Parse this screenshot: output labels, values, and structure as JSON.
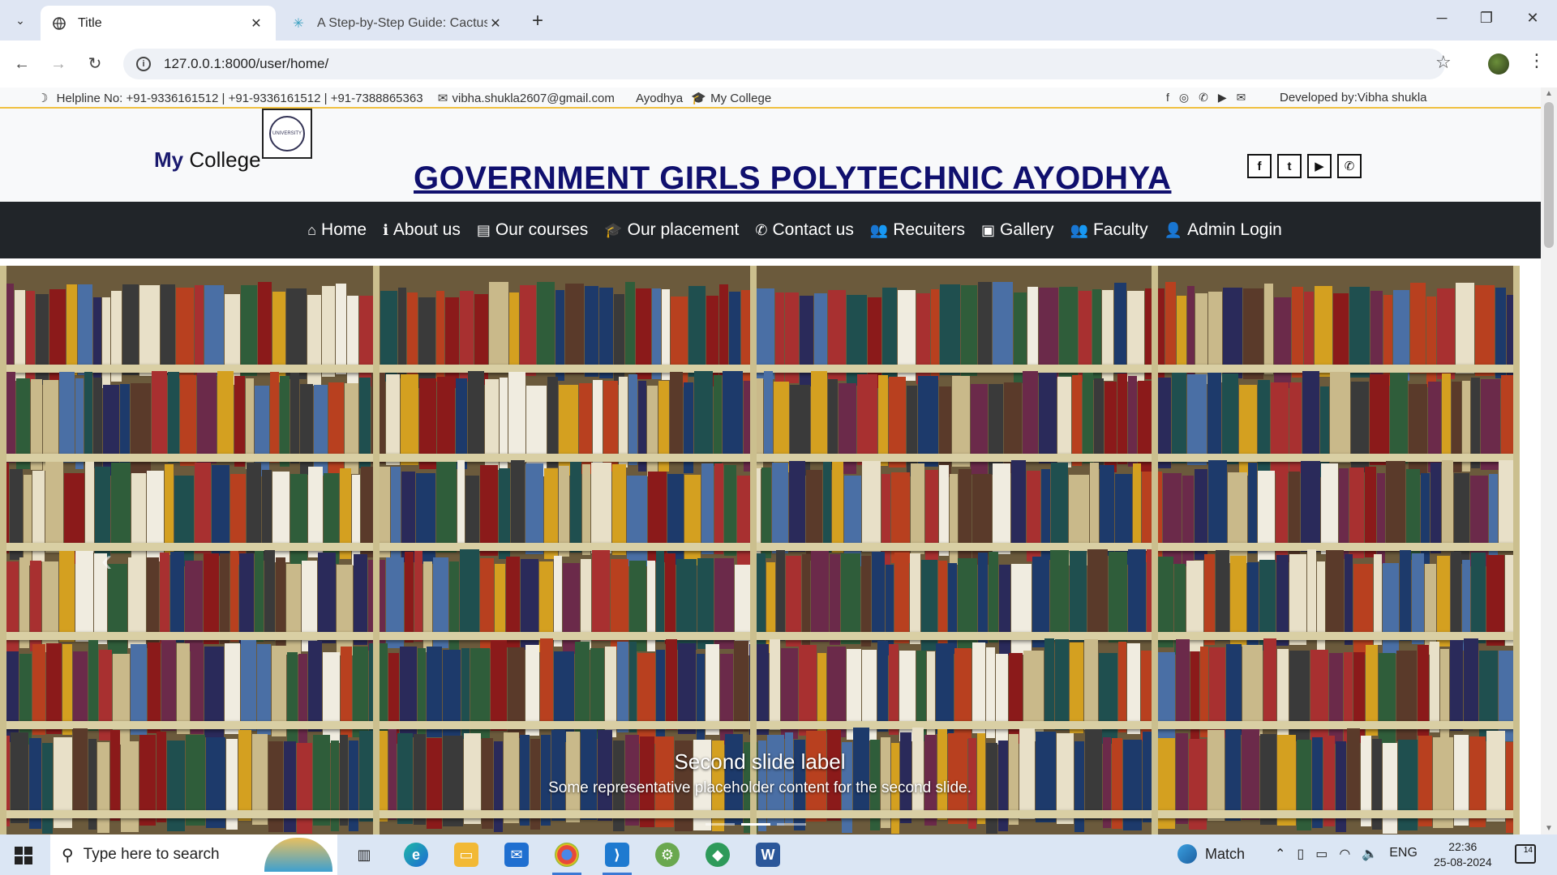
{
  "browser": {
    "tabs": [
      {
        "title": "Title",
        "active": true
      },
      {
        "title": "A Step-by-Step Guide: Cactus o",
        "active": false
      }
    ],
    "url": "127.0.0.1:8000/user/home/"
  },
  "topbar": {
    "helpline": "Helpline No: +91-9336161512 | +91-9336161512 | +91-7388865363",
    "email": "vibha.shukla2607@gmail.com",
    "city": "Ayodhya",
    "college": "My College",
    "developer": "Developed by:Vibha shukla",
    "social_icons": [
      "facebook-icon",
      "instagram-icon",
      "whatsapp-icon",
      "youtube-icon",
      "envelope-icon"
    ]
  },
  "header": {
    "brand_bold": "My",
    "brand_rest": "College",
    "logo_text": "UNIVERSITY",
    "title": "GOVERNMENT GIRLS POLYTECHNIC AYODHYA",
    "social": [
      {
        "name": "facebook-icon",
        "glyph": "f"
      },
      {
        "name": "twitter-icon",
        "glyph": "t"
      },
      {
        "name": "youtube-icon",
        "glyph": "▶"
      },
      {
        "name": "whatsapp-icon",
        "glyph": "✆"
      }
    ]
  },
  "nav": {
    "items": [
      {
        "label": "Home",
        "icon": "⌂",
        "icon_name": "home-icon"
      },
      {
        "label": "About us",
        "icon": "ℹ",
        "icon_name": "info-icon"
      },
      {
        "label": "Our courses",
        "icon": "▤",
        "icon_name": "book-icon"
      },
      {
        "label": "Our placement",
        "icon": "🎓",
        "icon_name": "graduation-cap-icon"
      },
      {
        "label": "Contact us",
        "icon": "✆",
        "icon_name": "phone-icon"
      },
      {
        "label": "Recuiters",
        "icon": "👥",
        "icon_name": "users-icon"
      },
      {
        "label": "Gallery",
        "icon": "▣",
        "icon_name": "image-icon"
      },
      {
        "label": "Faculty",
        "icon": "👥",
        "icon_name": "users-icon"
      },
      {
        "label": "Admin Login",
        "icon": "👤",
        "icon_name": "user-icon"
      }
    ]
  },
  "carousel": {
    "caption_title": "Second slide label",
    "caption_text": "Some representative placeholder content for the second slide.",
    "slide_count": 3,
    "active_slide": 2
  },
  "taskbar": {
    "search_placeholder": "Type here to search",
    "weather": "Match",
    "language": "ENG",
    "time": "22:36",
    "date": "25-08-2024",
    "notifications": "14"
  }
}
